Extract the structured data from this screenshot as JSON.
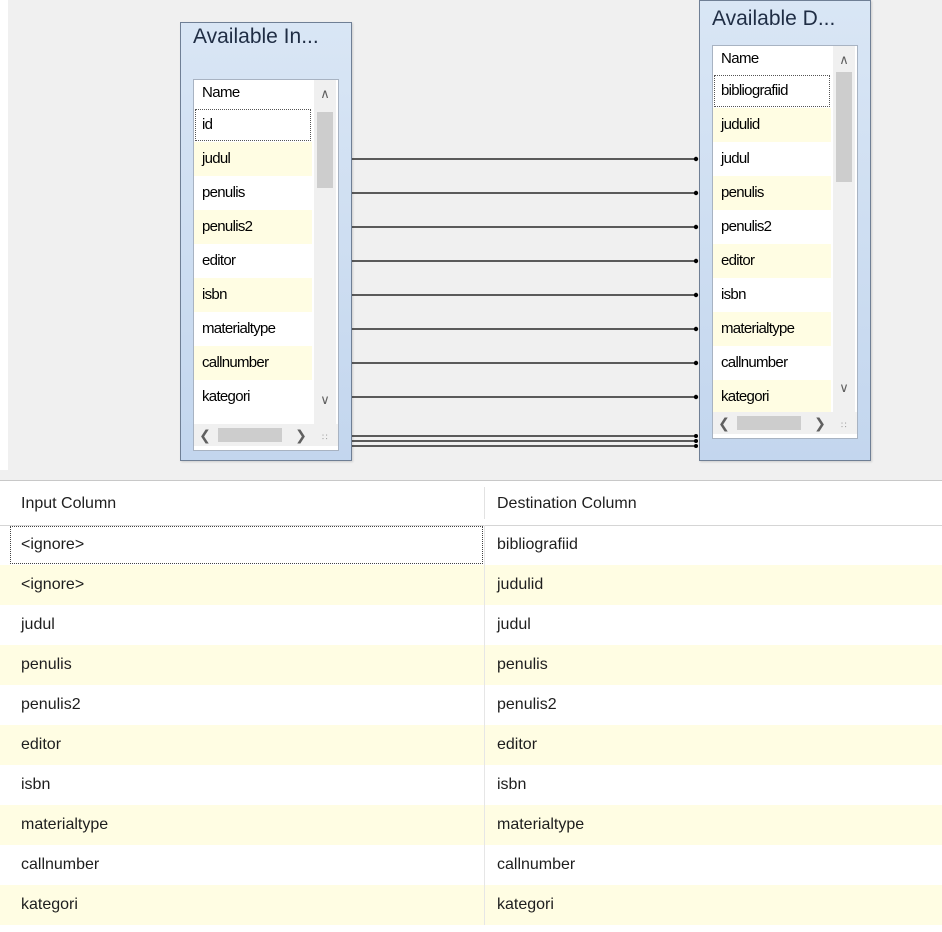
{
  "input_table": {
    "title": "Available In...",
    "column_header": "Name",
    "columns": [
      "id",
      "judul",
      "penulis",
      "penulis2",
      "editor",
      "isbn",
      "materialtype",
      "callnumber",
      "kategori"
    ]
  },
  "destination_table": {
    "title": "Available D...",
    "column_header": "Name",
    "columns": [
      "bibliografiid",
      "judulid",
      "judul",
      "penulis",
      "penulis2",
      "editor",
      "isbn",
      "materialtype",
      "callnumber",
      "kategori"
    ]
  },
  "grid": {
    "headers": {
      "input": "Input Column",
      "destination": "Destination Column"
    },
    "rows": [
      {
        "input": "<ignore>",
        "destination": "bibliografiid"
      },
      {
        "input": "<ignore>",
        "destination": "judulid"
      },
      {
        "input": "judul",
        "destination": "judul"
      },
      {
        "input": "penulis",
        "destination": "penulis"
      },
      {
        "input": "penulis2",
        "destination": "penulis2"
      },
      {
        "input": "editor",
        "destination": "editor"
      },
      {
        "input": "isbn",
        "destination": "isbn"
      },
      {
        "input": "materialtype",
        "destination": "materialtype"
      },
      {
        "input": "callnumber",
        "destination": "callnumber"
      },
      {
        "input": "kategori",
        "destination": "kategori"
      }
    ]
  },
  "colors": {
    "alt_row": "#fffde3",
    "canvas": "#f0f0f0",
    "box_gradient_top": "#d9e6f5",
    "box_gradient_bottom": "#c3d6ee"
  },
  "icons": {
    "scroll_up": "chevron-up-icon",
    "scroll_down": "chevron-down-icon",
    "scroll_left": "chevron-left-icon",
    "scroll_right": "chevron-right-icon",
    "resize_grip": "resize-grip-icon"
  }
}
